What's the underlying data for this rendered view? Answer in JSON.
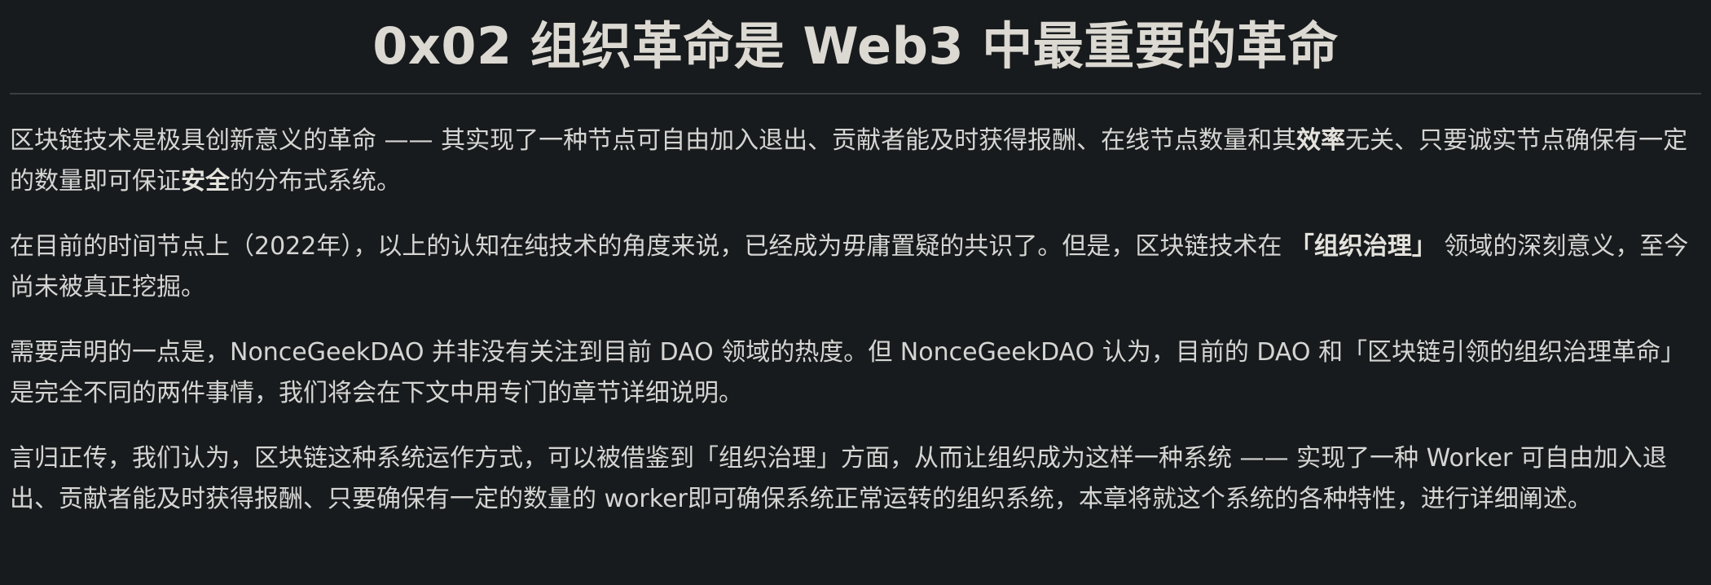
{
  "title": "0x02 组织革命是 Web3 中最重要的革命",
  "paragraphs": {
    "p1": {
      "t1": "区块链技术是极具创新意义的革命 —— 其实现了一种节点可自由加入退出、贡献者能及时获得报酬、在线节点数量和其",
      "b1": "效率",
      "t2": "无关、只要诚实节点确保有一定的数量即可保证",
      "b2": "安全",
      "t3": "的分布式系统。"
    },
    "p2": {
      "t1": "在目前的时间节点上（2022年），以上的认知在纯技术的角度来说，已经成为毋庸置疑的共识了。但是，区块链技术在 ",
      "b1": "「组织治理」",
      "t2": " 领域的深刻意义，至今尚未被真正挖掘。"
    },
    "p3": {
      "t1": "需要声明的一点是，NonceGeekDAO 并非没有关注到目前 DAO 领域的热度。但 NonceGeekDAO 认为，目前的 DAO 和「区块链引领的组织治理革命」是完全不同的两件事情，我们将会在下文中用专门的章节详细说明。"
    },
    "p4": {
      "t1": "言归正传，我们认为，区块链这种系统运作方式，可以被借鉴到「组织治理」方面，从而让组织成为这样一种系统 —— 实现了一种 Worker 可自由加入退出、贡献者能及时获得报酬、只要确保有一定的数量的 worker即可确保系统正常运转的组织系统，本章将就这个系统的各种特性，进行详细阐述。"
    }
  }
}
